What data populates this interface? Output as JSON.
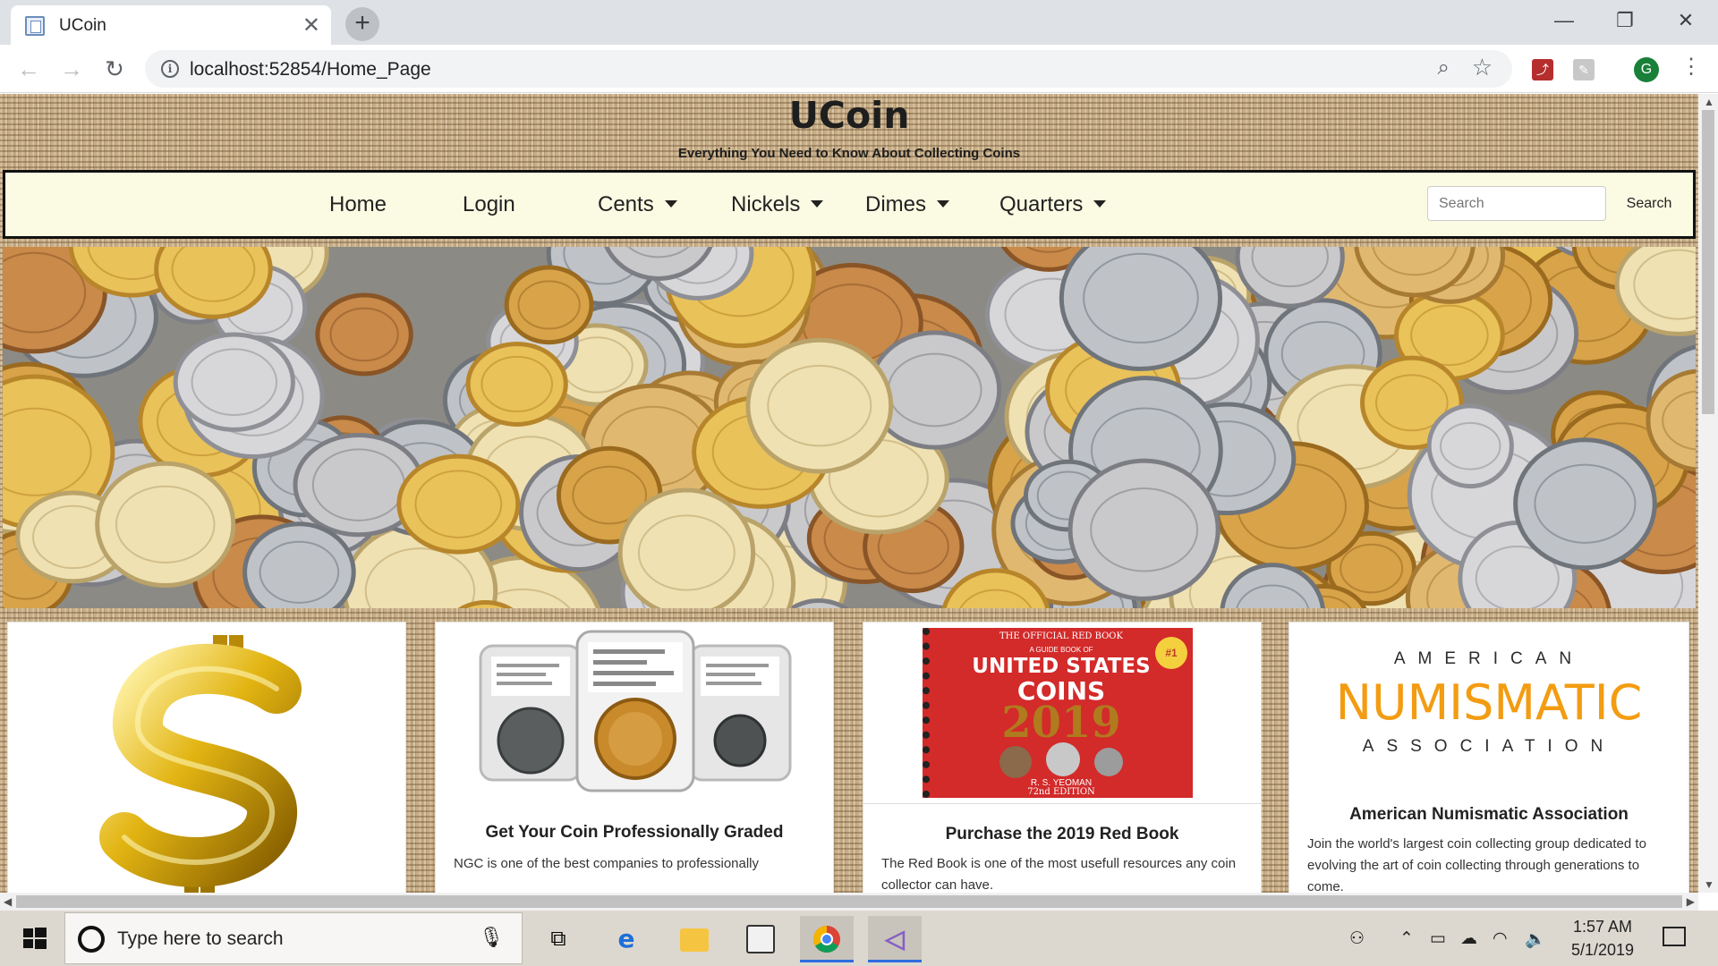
{
  "browser": {
    "tab_title": "UCoin",
    "new_tab_symbol": "+",
    "close_symbol": "✕",
    "url": "localhost:52854/Home_Page",
    "window_buttons": {
      "minimize": "—",
      "restore": "❐",
      "close": "✕"
    },
    "avatar_letter": "G"
  },
  "site": {
    "title": "UCoin",
    "tagline": "Everything You Need to Know About Collecting Coins"
  },
  "nav": {
    "items": [
      {
        "label": "Home",
        "dropdown": false
      },
      {
        "label": "Login",
        "dropdown": false
      },
      {
        "label": "Cents",
        "dropdown": true
      },
      {
        "label": "Nickels",
        "dropdown": true
      },
      {
        "label": "Dimes",
        "dropdown": true
      },
      {
        "label": "Quarters",
        "dropdown": true
      }
    ],
    "search_placeholder": "Search",
    "search_button": "Search"
  },
  "cards": [
    {
      "image": "gold-dollar-sign",
      "title": "",
      "text": ""
    },
    {
      "image": "ngc-graded-coin-slabs",
      "title": "Get Your Coin Professionally Graded",
      "text": "NGC is one of the best companies to professionally"
    },
    {
      "image": "red-book-2019-cover",
      "title": "Purchase the 2019 Red Book",
      "text": "The Red Book is one of the most usefull resources any coin collector can have.",
      "cover": {
        "banner": "THE OFFICIAL RED BOOK",
        "subtitle": "A GUIDE BOOK OF",
        "line1": "UNITED STATES",
        "line2": "COINS",
        "year": "2019",
        "author": "R. S. YEOMAN",
        "edition": "72nd EDITION",
        "badge": "#1"
      }
    },
    {
      "image": "ana-logo",
      "title": "American Numismatic Association",
      "text": "Join the world's largest coin collecting group dedicated to evolving the art of coin collecting through generations to come.",
      "logo": {
        "top": "AMERICAN",
        "middle": "NUMISMATIC",
        "bottom": "ASSOCIATION"
      }
    }
  ],
  "colors": {
    "burlap": "#c8ae88",
    "navbar_bg": "#fbfae3",
    "ana_orange": "#f39c12",
    "redbook_red": "#d32a2a"
  },
  "taskbar": {
    "search_text": "Type here to search",
    "time": "1:57 AM",
    "date": "5/1/2019",
    "apps": [
      "task-view-icon",
      "edge-icon",
      "file-explorer-icon",
      "store-icon",
      "chrome-icon",
      "visual-studio-icon"
    ]
  }
}
